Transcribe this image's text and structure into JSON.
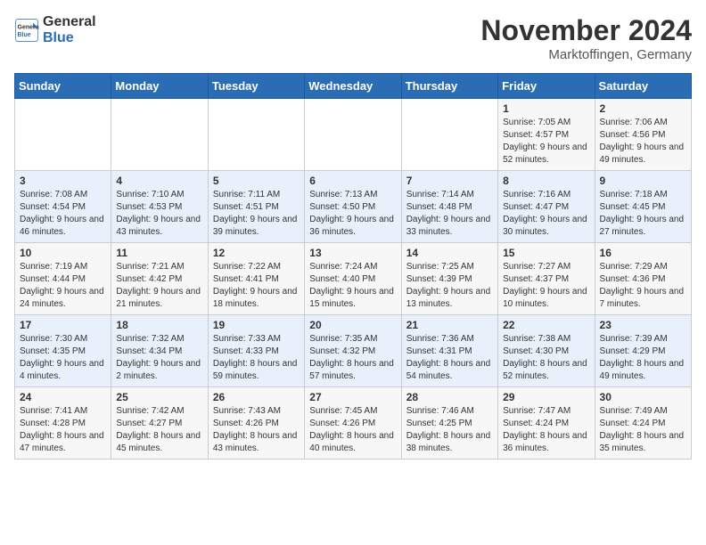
{
  "header": {
    "logo_line1": "General",
    "logo_line2": "Blue",
    "month": "November 2024",
    "location": "Marktoffingen, Germany"
  },
  "weekdays": [
    "Sunday",
    "Monday",
    "Tuesday",
    "Wednesday",
    "Thursday",
    "Friday",
    "Saturday"
  ],
  "weeks": [
    [
      null,
      null,
      null,
      null,
      null,
      {
        "day": "1",
        "sunrise": "7:05 AM",
        "sunset": "4:57 PM",
        "daylight": "9 hours and 52 minutes."
      },
      {
        "day": "2",
        "sunrise": "7:06 AM",
        "sunset": "4:56 PM",
        "daylight": "9 hours and 49 minutes."
      }
    ],
    [
      {
        "day": "3",
        "sunrise": "7:08 AM",
        "sunset": "4:54 PM",
        "daylight": "9 hours and 46 minutes."
      },
      {
        "day": "4",
        "sunrise": "7:10 AM",
        "sunset": "4:53 PM",
        "daylight": "9 hours and 43 minutes."
      },
      {
        "day": "5",
        "sunrise": "7:11 AM",
        "sunset": "4:51 PM",
        "daylight": "9 hours and 39 minutes."
      },
      {
        "day": "6",
        "sunrise": "7:13 AM",
        "sunset": "4:50 PM",
        "daylight": "9 hours and 36 minutes."
      },
      {
        "day": "7",
        "sunrise": "7:14 AM",
        "sunset": "4:48 PM",
        "daylight": "9 hours and 33 minutes."
      },
      {
        "day": "8",
        "sunrise": "7:16 AM",
        "sunset": "4:47 PM",
        "daylight": "9 hours and 30 minutes."
      },
      {
        "day": "9",
        "sunrise": "7:18 AM",
        "sunset": "4:45 PM",
        "daylight": "9 hours and 27 minutes."
      }
    ],
    [
      {
        "day": "10",
        "sunrise": "7:19 AM",
        "sunset": "4:44 PM",
        "daylight": "9 hours and 24 minutes."
      },
      {
        "day": "11",
        "sunrise": "7:21 AM",
        "sunset": "4:42 PM",
        "daylight": "9 hours and 21 minutes."
      },
      {
        "day": "12",
        "sunrise": "7:22 AM",
        "sunset": "4:41 PM",
        "daylight": "9 hours and 18 minutes."
      },
      {
        "day": "13",
        "sunrise": "7:24 AM",
        "sunset": "4:40 PM",
        "daylight": "9 hours and 15 minutes."
      },
      {
        "day": "14",
        "sunrise": "7:25 AM",
        "sunset": "4:39 PM",
        "daylight": "9 hours and 13 minutes."
      },
      {
        "day": "15",
        "sunrise": "7:27 AM",
        "sunset": "4:37 PM",
        "daylight": "9 hours and 10 minutes."
      },
      {
        "day": "16",
        "sunrise": "7:29 AM",
        "sunset": "4:36 PM",
        "daylight": "9 hours and 7 minutes."
      }
    ],
    [
      {
        "day": "17",
        "sunrise": "7:30 AM",
        "sunset": "4:35 PM",
        "daylight": "9 hours and 4 minutes."
      },
      {
        "day": "18",
        "sunrise": "7:32 AM",
        "sunset": "4:34 PM",
        "daylight": "9 hours and 2 minutes."
      },
      {
        "day": "19",
        "sunrise": "7:33 AM",
        "sunset": "4:33 PM",
        "daylight": "8 hours and 59 minutes."
      },
      {
        "day": "20",
        "sunrise": "7:35 AM",
        "sunset": "4:32 PM",
        "daylight": "8 hours and 57 minutes."
      },
      {
        "day": "21",
        "sunrise": "7:36 AM",
        "sunset": "4:31 PM",
        "daylight": "8 hours and 54 minutes."
      },
      {
        "day": "22",
        "sunrise": "7:38 AM",
        "sunset": "4:30 PM",
        "daylight": "8 hours and 52 minutes."
      },
      {
        "day": "23",
        "sunrise": "7:39 AM",
        "sunset": "4:29 PM",
        "daylight": "8 hours and 49 minutes."
      }
    ],
    [
      {
        "day": "24",
        "sunrise": "7:41 AM",
        "sunset": "4:28 PM",
        "daylight": "8 hours and 47 minutes."
      },
      {
        "day": "25",
        "sunrise": "7:42 AM",
        "sunset": "4:27 PM",
        "daylight": "8 hours and 45 minutes."
      },
      {
        "day": "26",
        "sunrise": "7:43 AM",
        "sunset": "4:26 PM",
        "daylight": "8 hours and 43 minutes."
      },
      {
        "day": "27",
        "sunrise": "7:45 AM",
        "sunset": "4:26 PM",
        "daylight": "8 hours and 40 minutes."
      },
      {
        "day": "28",
        "sunrise": "7:46 AM",
        "sunset": "4:25 PM",
        "daylight": "8 hours and 38 minutes."
      },
      {
        "day": "29",
        "sunrise": "7:47 AM",
        "sunset": "4:24 PM",
        "daylight": "8 hours and 36 minutes."
      },
      {
        "day": "30",
        "sunrise": "7:49 AM",
        "sunset": "4:24 PM",
        "daylight": "8 hours and 35 minutes."
      }
    ]
  ]
}
